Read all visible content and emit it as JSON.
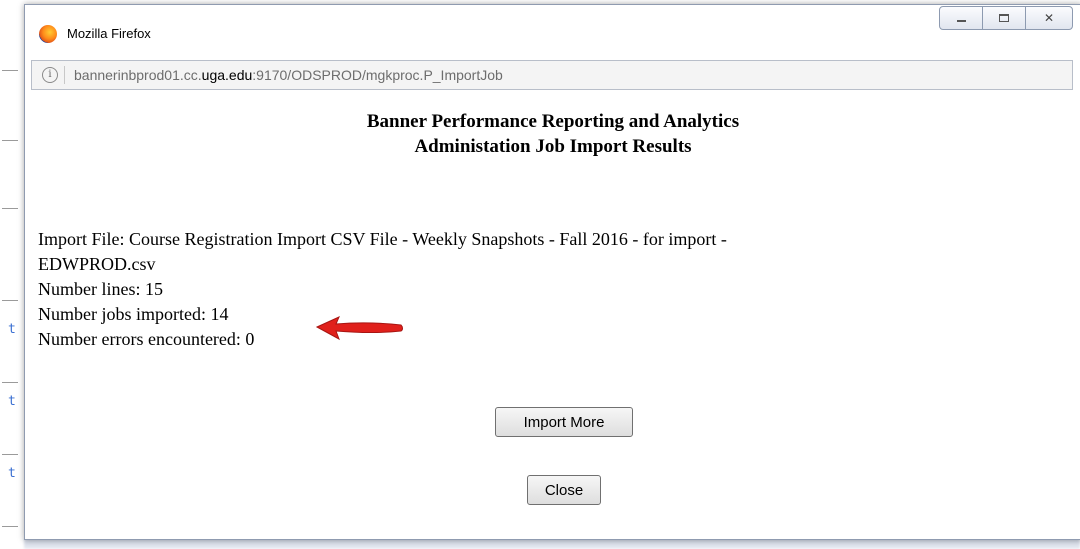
{
  "window": {
    "title": "Mozilla Firefox",
    "url_prefix": "bannerinbprod01.cc.",
    "url_host": "uga.edu",
    "url_suffix": ":9170/ODSPROD/mgkproc.P_ImportJob"
  },
  "page": {
    "heading_line1": "Banner Performance Reporting and Analytics",
    "heading_line2": "Administation Job Import Results",
    "import_file_line1": "Import File: Course Registration Import CSV File - Weekly Snapshots - Fall 2016 - for import -",
    "import_file_line2": "EDWPROD.csv",
    "number_lines": "Number lines: 15",
    "number_jobs_imported": "Number jobs imported: 14",
    "number_errors": "Number errors encountered: 0",
    "import_more_label": "Import More",
    "close_label": "Close"
  },
  "background": {
    "link_glyph": "t"
  },
  "colors": {
    "arrow": "#e0201b",
    "link": "#3a6fd1"
  },
  "icons": {
    "browser": "firefox-icon",
    "info": "info-icon",
    "annotation": "red-arrow-icon"
  }
}
